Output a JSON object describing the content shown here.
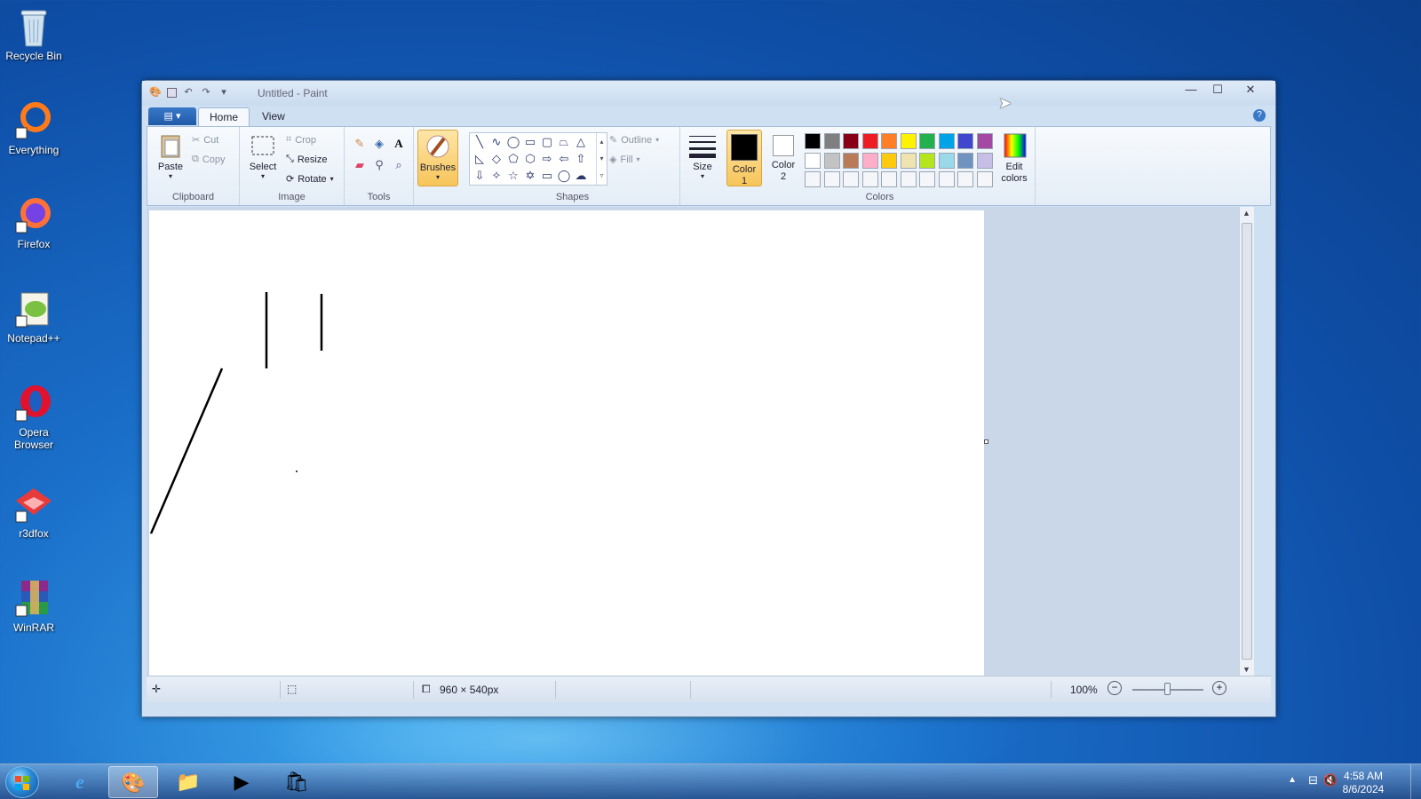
{
  "desktop": {
    "icons": [
      {
        "label": "Recycle Bin"
      },
      {
        "label": "Everything"
      },
      {
        "label": "Firefox"
      },
      {
        "label": "Notepad++"
      },
      {
        "label": "Opera Browser"
      },
      {
        "label": "r3dfox"
      },
      {
        "label": "WinRAR"
      }
    ]
  },
  "window": {
    "title": "Untitled - Paint",
    "controls": {
      "minimize": "—",
      "maximize": "☐",
      "close": "✕"
    }
  },
  "ribbon": {
    "file_menu": "▤ ▾",
    "tabs": [
      {
        "label": "Home",
        "active": true
      },
      {
        "label": "View",
        "active": false
      }
    ],
    "clipboard": {
      "label": "Clipboard",
      "paste": "Paste",
      "cut": "Cut",
      "copy": "Copy"
    },
    "image": {
      "label": "Image",
      "select": "Select",
      "crop": "Crop",
      "resize": "Resize",
      "rotate": "Rotate"
    },
    "tools": {
      "label": "Tools"
    },
    "brushes": {
      "label": "Brushes"
    },
    "shapes": {
      "label": "Shapes",
      "outline": "Outline",
      "fill": "Fill"
    },
    "size": {
      "label": "Size"
    },
    "colors": {
      "label": "Colors",
      "color1": "Color\n1",
      "color2": "Color\n2",
      "color1_value": "#000000",
      "color2_value": "#ffffff",
      "edit": "Edit colors",
      "palette_row1": [
        "#000000",
        "#7f7f7f",
        "#880015",
        "#ed1c24",
        "#ff7f27",
        "#fff200",
        "#22b14c",
        "#00a2e8",
        "#3f48cc",
        "#a349a4"
      ],
      "palette_row2": [
        "#ffffff",
        "#c3c3c3",
        "#b97a57",
        "#ffaec9",
        "#ffc90e",
        "#efe4b0",
        "#b5e61d",
        "#99d9ea",
        "#7092be",
        "#c8bfe7"
      ]
    }
  },
  "status": {
    "canvas_size": "960 × 540px",
    "zoom": "100%"
  },
  "taskbar": {
    "time": "4:58 AM",
    "date": "8/6/2024"
  }
}
